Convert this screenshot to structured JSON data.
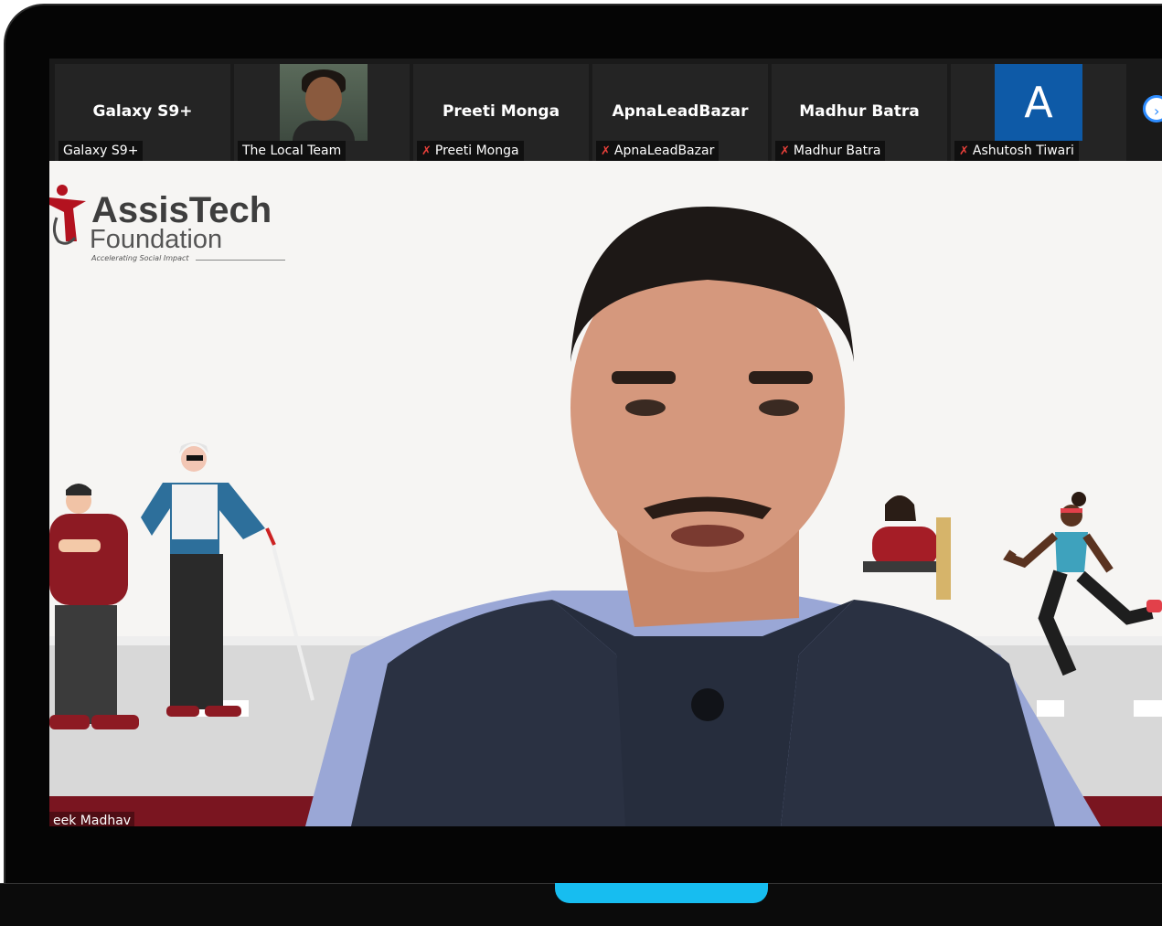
{
  "participants": [
    {
      "display": "Galaxy S9+",
      "label": "Galaxy S9+",
      "muted": false,
      "kind": "name"
    },
    {
      "display": "",
      "label": "The Local Team",
      "muted": false,
      "kind": "photo"
    },
    {
      "display": "Preeti Monga",
      "label": "Preeti Monga",
      "muted": true,
      "kind": "name"
    },
    {
      "display": "ApnaLeadBazar",
      "label": "ApnaLeadBazar",
      "muted": true,
      "kind": "name"
    },
    {
      "display": "Madhur Batra",
      "label": "Madhur Batra",
      "muted": true,
      "kind": "name"
    },
    {
      "display": "A",
      "label": "Ashutosh Tiwari",
      "muted": true,
      "kind": "avatar"
    }
  ],
  "mic_muted_glyph": "✗",
  "next_page_glyph": "›",
  "main": {
    "speaker_label": "eek Madhav",
    "logo": {
      "title": "AssisTech",
      "subtitle": "Foundation",
      "tagline": "Accelerating Social Impact"
    }
  },
  "colors": {
    "zoom_blue": "#2d8cff",
    "avatar_blue": "#0e5aa7",
    "muted_red": "#e8403a",
    "brand_maroon": "#7a1520",
    "laptop_accent": "#17bdf0"
  },
  "icons": [
    "mic-muted-icon",
    "next-page-icon",
    "assistech-logo-icon"
  ]
}
